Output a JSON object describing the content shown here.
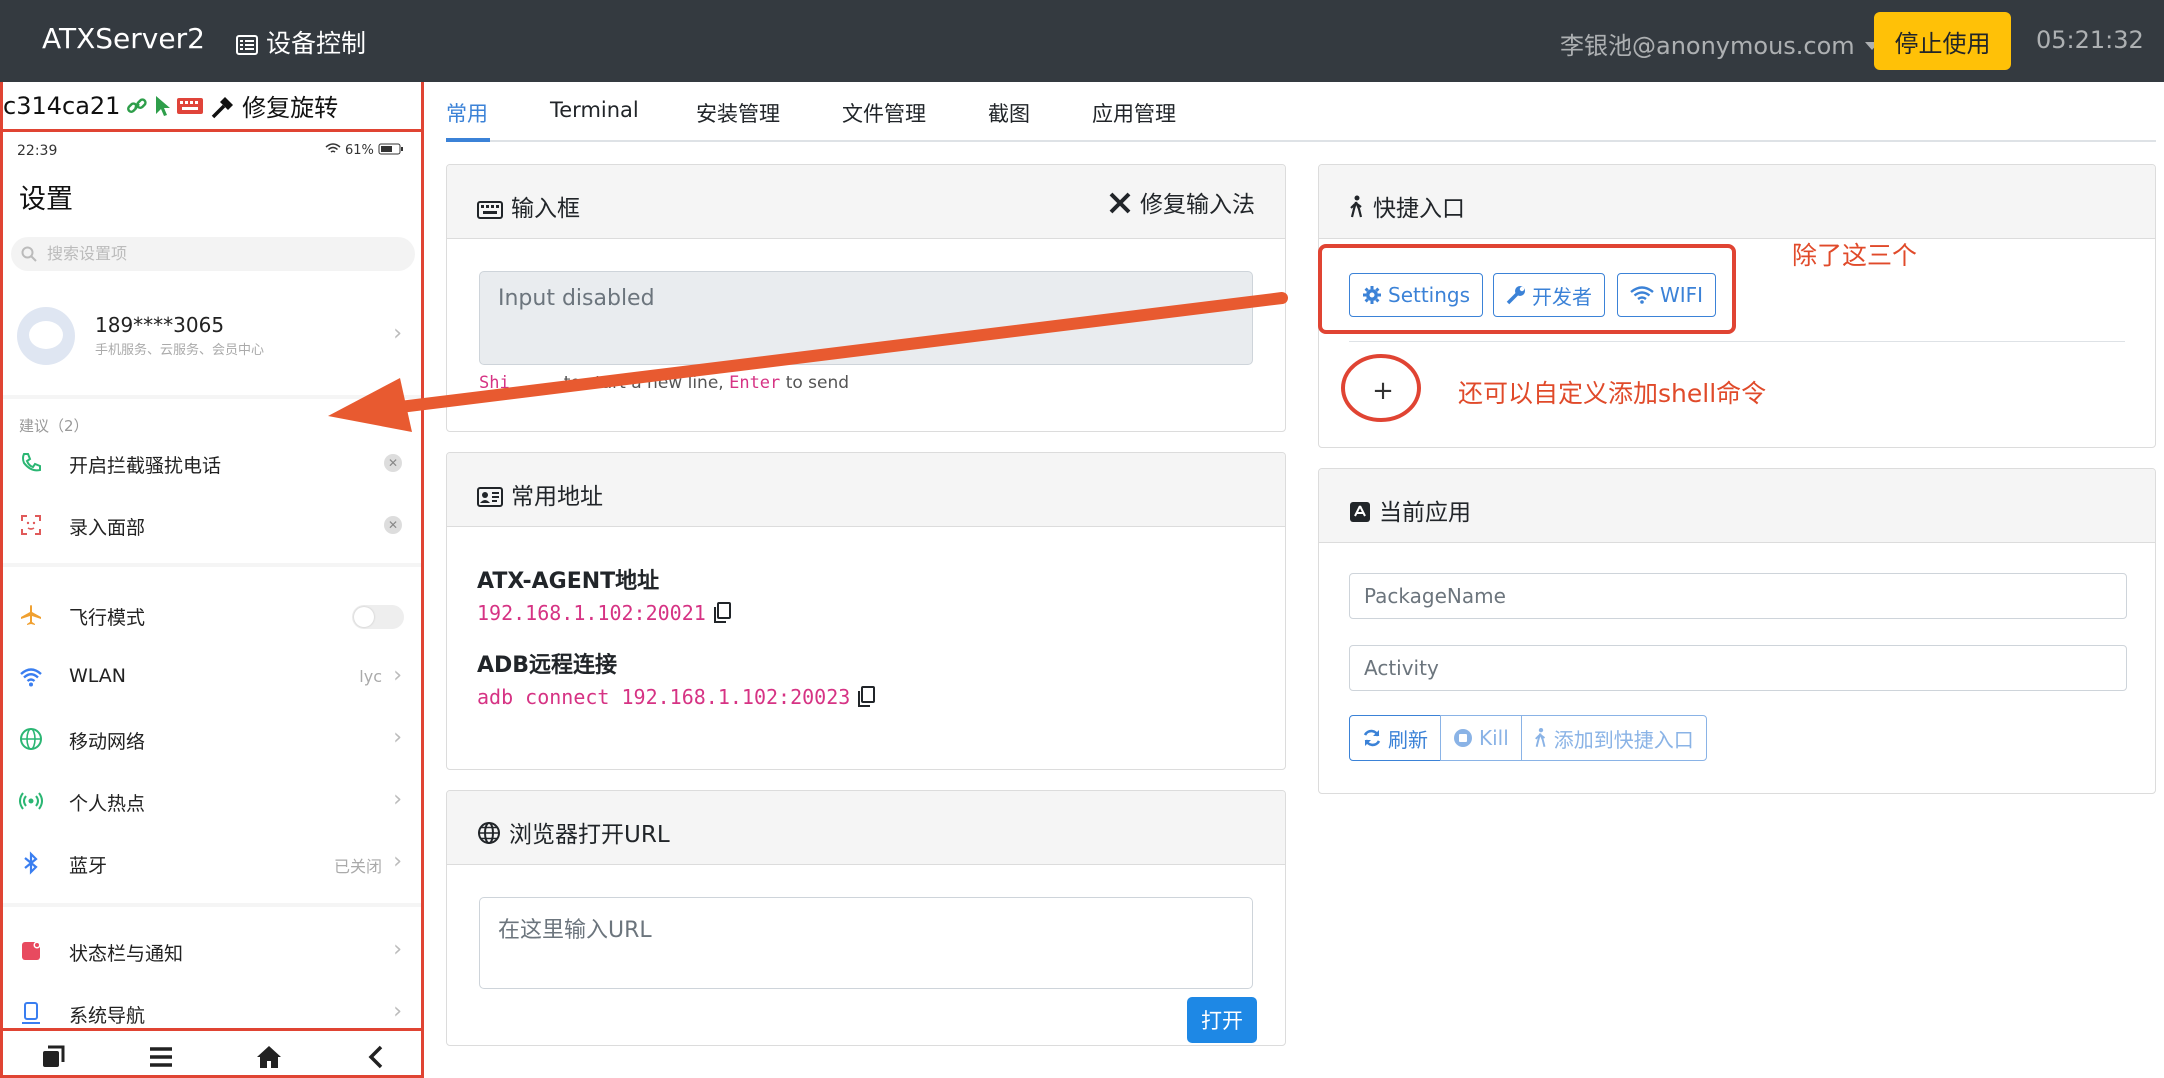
{
  "navbar": {
    "brand": "ATXServer2",
    "device_control": "设备控制",
    "user": "李银池@anonymous.com",
    "stop_button": "停止使用",
    "time": "05:21:32"
  },
  "device": {
    "id": "c314ca21",
    "fix_rotation": "修复旋转"
  },
  "phone": {
    "status_time": "22:39",
    "status_right": "61%",
    "title": "设置",
    "search_placeholder": "搜索设置项",
    "profile_number": "189****3065",
    "profile_sub": "手机服务、云服务、会员中心",
    "suggest_label": "建议（2）",
    "suggestions": [
      {
        "label": "开启拦截骚扰电话"
      },
      {
        "label": "录入面部"
      }
    ],
    "items": [
      {
        "label": "飞行模式",
        "value": ""
      },
      {
        "label": "WLAN",
        "value": "lyc"
      },
      {
        "label": "移动网络",
        "value": ""
      },
      {
        "label": "个人热点",
        "value": ""
      },
      {
        "label": "蓝牙",
        "value": "已关闭"
      }
    ],
    "items2": [
      {
        "label": "状态栏与通知"
      },
      {
        "label": "系统导航"
      }
    ]
  },
  "tabs": [
    {
      "label": "常用"
    },
    {
      "label": "Terminal"
    },
    {
      "label": "安装管理"
    },
    {
      "label": "文件管理"
    },
    {
      "label": "截图"
    },
    {
      "label": "应用管理"
    }
  ],
  "input_card": {
    "title": "输入框",
    "fix_ime": "修复输入法",
    "placeholder": "Input disabled",
    "hint_start": "Shi",
    "hint_mid": "to start a new line,",
    "hint_enter": "Enter",
    "hint_end": "to send"
  },
  "address_card": {
    "title": "常用地址",
    "agent_label": "ATX-AGENT地址",
    "agent_value": "192.168.1.102:20021",
    "adb_label": "ADB远程连接",
    "adb_value": "adb connect 192.168.1.102:20023"
  },
  "browser_card": {
    "title": "浏览器打开URL",
    "placeholder": "在这里输入URL",
    "open_button": "打开"
  },
  "shortcut_card": {
    "title": "快捷入口",
    "buttons": [
      {
        "label": "Settings",
        "icon": "gear-icon"
      },
      {
        "label": "开发者",
        "icon": "wrench-icon"
      },
      {
        "label": "WIFI",
        "icon": "wifi-icon"
      }
    ],
    "add_button": "+"
  },
  "current_app_card": {
    "title": "当前应用",
    "package_placeholder": "PackageName",
    "activity_placeholder": "Activity",
    "refresh": "刷新",
    "kill": "Kill",
    "add_shortcut": "添加到快捷入口"
  },
  "annotations": {
    "except_three": "除了这三个",
    "custom_shell": "还可以自定义添加shell命令"
  },
  "colors": {
    "navbar": "#343a40",
    "accent": "#3b82d7",
    "warning": "#ffc107",
    "annotation": "#e04433",
    "code": "#d63384"
  }
}
